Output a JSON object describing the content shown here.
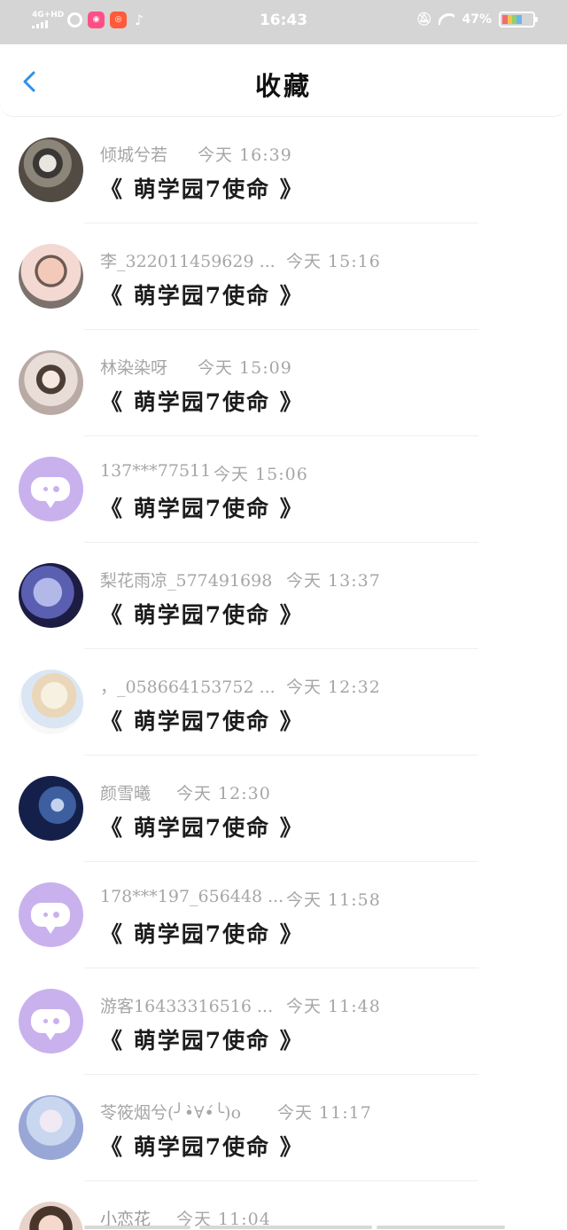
{
  "status_bar": {
    "network": "4G+HD",
    "time": "16:43",
    "battery": "47%",
    "app_icons": [
      "qq-browser-icon",
      "wowo-icon",
      "xiaohongshu-icon",
      "tiktok-icon"
    ]
  },
  "nav": {
    "title": "收藏",
    "back_icon": "chevron-left-icon",
    "accent": "#2f8fe9"
  },
  "favorites": [
    {
      "name": "倾城兮若",
      "time": "今天 16:39",
      "content": "《 萌学园7使命 》",
      "avatar": "photo"
    },
    {
      "name": "李_322011459629 ...",
      "time": "今天 15:16",
      "content": "《 萌学园7使命 》",
      "avatar": "photo"
    },
    {
      "name": "林染染呀",
      "time": "今天 15:09",
      "content": "《 萌学园7使命 》",
      "avatar": "photo"
    },
    {
      "name": "137***77511",
      "time": "今天 15:06",
      "content": "《 萌学园7使命 》",
      "avatar": "default"
    },
    {
      "name": "梨花雨凉_577491698",
      "time": "今天 13:37",
      "content": "《 萌学园7使命 》",
      "avatar": "photo"
    },
    {
      "name": "，_058664153752 ...",
      "time": "今天 12:32",
      "content": "《 萌学园7使命 》",
      "avatar": "photo"
    },
    {
      "name": "颜雪曦",
      "time": "今天 12:30",
      "content": "《 萌学园7使命 》",
      "avatar": "photo"
    },
    {
      "name": "178***197_656448 ...",
      "time": "今天 11:58",
      "content": "《 萌学园7使命 》",
      "avatar": "default"
    },
    {
      "name": "游客16433316516 ...",
      "time": "今天 11:48",
      "content": "《 萌学园7使命 》",
      "avatar": "default"
    },
    {
      "name": "苓筱烟兮(╯•̀∀•́╰)o",
      "time": "今天 11:17",
      "content": "《 萌学园7使命 》",
      "avatar": "photo"
    },
    {
      "name": "小恋花",
      "time": "今天 11:04",
      "content": "",
      "avatar": "photo"
    }
  ]
}
